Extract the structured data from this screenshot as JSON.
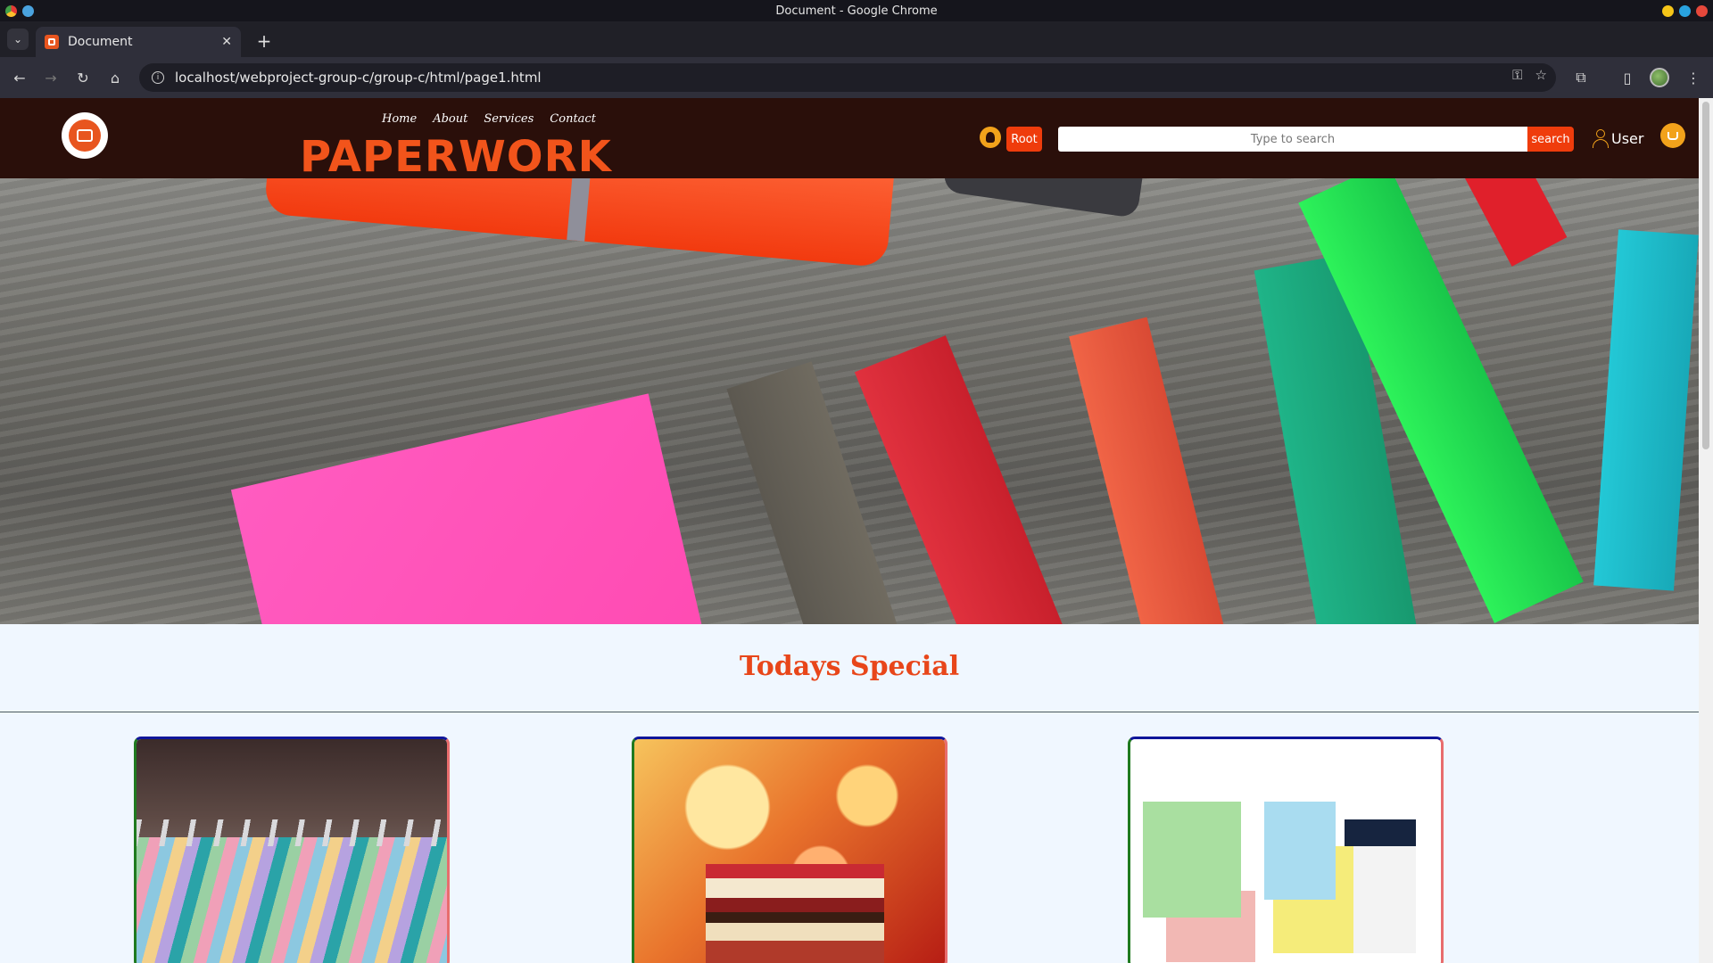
{
  "window": {
    "title": "Document - Google Chrome"
  },
  "tabs": [
    {
      "label": "Document"
    }
  ],
  "toolbar": {
    "url": "localhost/webproject-group-c/group-c/html/page1.html"
  },
  "site": {
    "brand": "PAPERWORK",
    "nav": [
      "Home",
      "About",
      "Services",
      "Contact"
    ],
    "root_label": "Root",
    "search": {
      "placeholder": "Type to search",
      "button_label": "search"
    },
    "user_label": "User"
  },
  "special": {
    "title": "Todays Special",
    "cards": [
      {
        "image": "colored-pencils-photo"
      },
      {
        "image": "stack-of-books-photo"
      },
      {
        "image": "receipt-notepads-and-pen-photo"
      }
    ]
  },
  "colors": {
    "header_bg": "#2a0f0a",
    "accent": "#ef3c0c",
    "brand": "#f2541b",
    "page_bg": "#f0f7ff"
  }
}
